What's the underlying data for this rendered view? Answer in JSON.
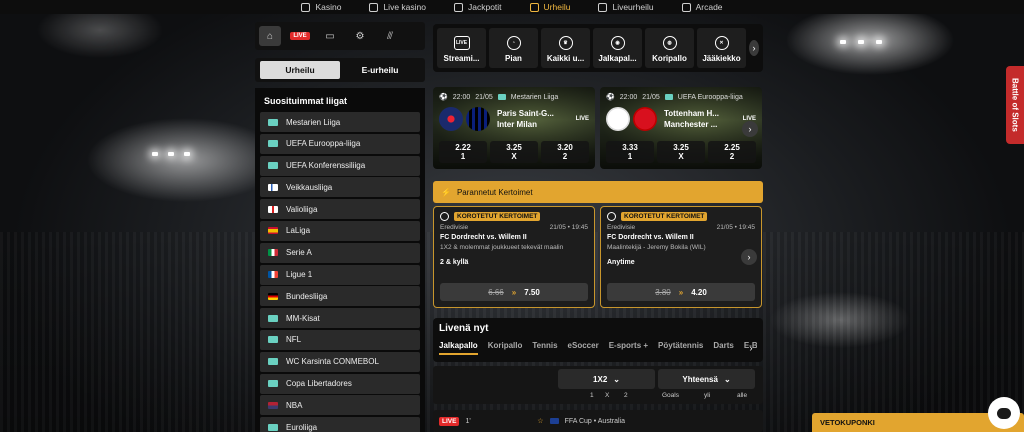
{
  "topnav": {
    "items": [
      {
        "label": "Kasino",
        "icon": "slot-icon"
      },
      {
        "label": "Live kasino",
        "icon": "live-casino-icon"
      },
      {
        "label": "Jackpotit",
        "icon": "seven-icon"
      },
      {
        "label": "Urheilu",
        "icon": "basketball-icon",
        "active": true
      },
      {
        "label": "Liveurheilu",
        "icon": "live-sport-icon"
      },
      {
        "label": "Arcade",
        "icon": "joystick-icon"
      }
    ]
  },
  "iconrow": {
    "live_label": "LIVE"
  },
  "segments": {
    "sports": "Urheilu",
    "esports": "E-urheilu"
  },
  "leagues": {
    "title": "Suosituimmat liigat",
    "items": [
      {
        "label": "Mestarien Liiga",
        "flag": "#6ad1c1"
      },
      {
        "label": "UEFA Eurooppa-liiga",
        "flag": "#6ad1c1"
      },
      {
        "label": "UEFA Konferenssiliiga",
        "flag": "#6ad1c1"
      },
      {
        "label": "Veikkausliiga",
        "flag": "finland"
      },
      {
        "label": "Valioliiga",
        "flag": "england"
      },
      {
        "label": "LaLiga",
        "flag": "spain"
      },
      {
        "label": "Serie A",
        "flag": "italy"
      },
      {
        "label": "Ligue 1",
        "flag": "france"
      },
      {
        "label": "Bundesliiga",
        "flag": "germany"
      },
      {
        "label": "MM-Kisat",
        "flag": "#6ad1c1"
      },
      {
        "label": "NFL",
        "flag": "#6ad1c1"
      },
      {
        "label": "WC Karsinta CONMEBOL",
        "flag": "#6ad1c1"
      },
      {
        "label": "Copa Libertadores",
        "flag": "#6ad1c1"
      },
      {
        "label": "NBA",
        "flag": "usa"
      },
      {
        "label": "Euroliiga",
        "flag": "#6ad1c1"
      }
    ]
  },
  "sports": [
    {
      "label": "Streami...",
      "icon": "live-tv-icon"
    },
    {
      "label": "Pian",
      "icon": "clock-icon"
    },
    {
      "label": "Kaikki u...",
      "icon": "trophy-icon"
    },
    {
      "label": "Jalkapal...",
      "icon": "football-icon"
    },
    {
      "label": "Koripallo",
      "icon": "basketball-icon"
    },
    {
      "label": "Jääkiekko",
      "icon": "hockey-icon"
    }
  ],
  "featured": [
    {
      "time": "22:00",
      "date": "21/05",
      "league": "Mestarien Liiga",
      "home": "Paris Saint-G...",
      "away": "Inter Milan",
      "live": "LIVE",
      "odds": [
        {
          "v": "2.22",
          "k": "1"
        },
        {
          "v": "3.25",
          "k": "X"
        },
        {
          "v": "3.20",
          "k": "2"
        }
      ]
    },
    {
      "time": "22:00",
      "date": "21/05",
      "league": "UEFA Eurooppa-liiga",
      "home": "Tottenham H...",
      "away": "Manchester ...",
      "live": "LIVE",
      "odds": [
        {
          "v": "3.33",
          "k": "1"
        },
        {
          "v": "3.25",
          "k": "X"
        },
        {
          "v": "2.25",
          "k": "2"
        }
      ]
    }
  ],
  "boosted": {
    "header": "Parannetut Kertoimet",
    "cards": [
      {
        "badge": "KOROTETUT KERTOIMET",
        "league": "Eredivisie",
        "datetime": "21/05 • 19:45",
        "match": "FC Dordrecht vs. Willem II",
        "desc": "1X2 & molemmat joukkueet tekevät maalin",
        "selection": "2 & kyllä",
        "old": "6.66",
        "new": "7.50"
      },
      {
        "badge": "KOROTETUT KERTOIMET",
        "league": "Eredivisie",
        "datetime": "21/05 • 19:45",
        "match": "FC Dordrecht vs. Willem II",
        "desc": "Maalintekijä - Jeremy Bokila (WIL)",
        "selection": "Anytime",
        "old": "3.80",
        "new": "4.20"
      }
    ]
  },
  "live": {
    "title": "Livenä nyt",
    "tabs": [
      "Jalkapallo",
      "Koripallo",
      "Tennis",
      "eSoccer",
      "E-sports +",
      "Pöytätennis",
      "Darts",
      "E-Basketba"
    ],
    "market1": "1X2",
    "market2": "Yhteensä",
    "cols1": [
      "1",
      "X",
      "2"
    ],
    "cols2": [
      "Goals",
      "yli",
      "alle"
    ],
    "row": {
      "badge": "LIVE",
      "minute": "1'",
      "competition": "FFA Cup • Australia"
    }
  },
  "side_tab": "Battle of Slots",
  "coupon": "VETOKUPONKI"
}
